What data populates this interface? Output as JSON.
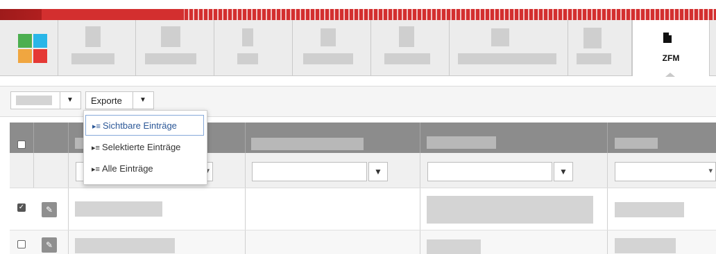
{
  "nav": {
    "active_label": "ZFM",
    "active_icon": "document-icon"
  },
  "toolbar": {
    "view_select_caret": "▼",
    "exports_label": "Exporte",
    "exports_caret": "▼"
  },
  "export_menu": {
    "items": [
      {
        "label": "Sichtbare Einträge",
        "icon": "▸≡",
        "selected": true
      },
      {
        "label": "Selektierte Einträge",
        "icon": "▸≡",
        "selected": false
      },
      {
        "label": "Alle Einträge",
        "icon": "▸≡",
        "selected": false
      }
    ]
  },
  "grid": {
    "filter_icon": "▼",
    "dropdown_caret": "▾",
    "row1_checked": "✓",
    "edit_icon": "✎"
  },
  "colors": {
    "brand_red": "#d32f2f",
    "header_gray": "#8c8c8c",
    "selected_blue": "#2b5797"
  }
}
